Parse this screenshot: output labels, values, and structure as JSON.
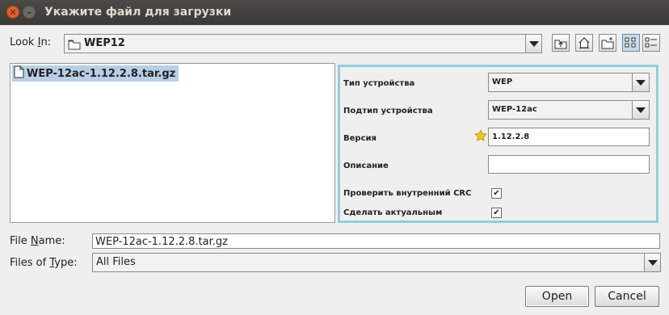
{
  "window": {
    "title": "Укажите файл для загрузки",
    "close_glyph": "✕",
    "minimize_glyph": "–"
  },
  "lookin": {
    "label_pre": "Look ",
    "label_u": "I",
    "label_post": "n:",
    "value": "WEP12"
  },
  "toolbar": {
    "icons": [
      "up-one-level-icon",
      "home-icon",
      "new-folder-icon",
      "list-view-icon",
      "details-view-icon"
    ]
  },
  "files": [
    {
      "name": "WEP-12ac-1.12.2.8.tar.gz",
      "selected": true
    }
  ],
  "panel": {
    "device_type": {
      "label": "Тип устройства",
      "value": "WEP"
    },
    "device_subtype": {
      "label": "Подтип устройства",
      "value": "WEP-12ac"
    },
    "version": {
      "label": "Версия",
      "value": "1.12.2.8"
    },
    "description": {
      "label": "Описание",
      "value": ""
    },
    "check_crc": {
      "label": "Проверить внутренний CRC",
      "checked": true,
      "mark": "✔"
    },
    "make_current": {
      "label": "Сделать актуальным",
      "checked": true,
      "mark": "✔"
    },
    "border_color": "#8ecfdc"
  },
  "filename": {
    "label_pre": "File ",
    "label_u": "N",
    "label_post": "ame:",
    "value": "WEP-12ac-1.12.2.8.tar.gz"
  },
  "filetype": {
    "label_pre": "Files of ",
    "label_u": "T",
    "label_post": "ype:",
    "value": "All Files"
  },
  "buttons": {
    "open": "Open",
    "cancel": "Cancel"
  },
  "colors": {
    "selection": "#b8cfe5",
    "titlebar": "#3e3d39",
    "close": "#e85b2a"
  }
}
